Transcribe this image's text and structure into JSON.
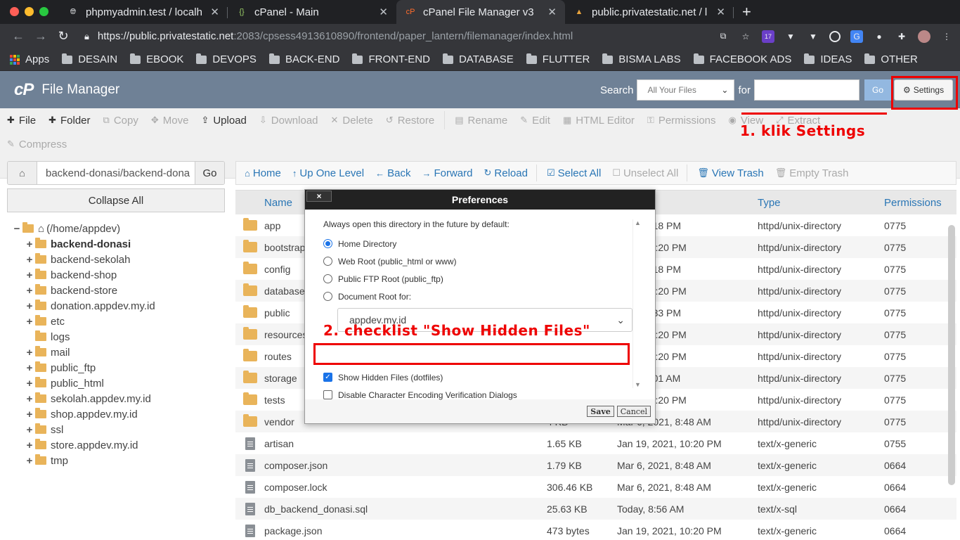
{
  "browser": {
    "tabs": [
      {
        "title": "phpmyadmin.test / localh",
        "icon": "globe-icon",
        "active": false
      },
      {
        "title": "cPanel - Main",
        "icon": "cpanel-brackets-icon",
        "active": false
      },
      {
        "title": "cPanel File Manager v3",
        "icon": "cpanel-icon",
        "active": true
      },
      {
        "title": "public.privatestatic.net / l",
        "icon": "pma-icon",
        "active": false
      }
    ],
    "url_host": "https://public.privatestatic.net",
    "url_path": ":2083/cpsess4913610890/frontend/paper_lantern/filemanager/index.html",
    "extension_badge": "17",
    "bookmarks": [
      "Apps",
      "DESAIN",
      "EBOOK",
      "DEVOPS",
      "BACK-END",
      "FRONT-END",
      "DATABASE",
      "FLUTTER",
      "BISMA LABS",
      "FACEBOOK ADS",
      "IDEAS",
      "OTHER"
    ]
  },
  "header": {
    "logo": "cP",
    "title": "File Manager",
    "search_label": "Search",
    "search_scope": "All Your Files",
    "for_label": "for",
    "go_label": "Go",
    "settings_label": "Settings"
  },
  "toolbar": {
    "row1": [
      {
        "label": "File",
        "icon": "plus-icon",
        "enabled": true
      },
      {
        "label": "Folder",
        "icon": "plus-icon",
        "enabled": true
      },
      {
        "label": "Copy",
        "icon": "copy-icon",
        "enabled": false
      },
      {
        "label": "Move",
        "icon": "move-icon",
        "enabled": false
      },
      {
        "label": "Upload",
        "icon": "upload-icon",
        "enabled": true
      },
      {
        "label": "Download",
        "icon": "download-icon",
        "enabled": false
      },
      {
        "label": "Delete",
        "icon": "delete-icon",
        "enabled": false
      },
      {
        "label": "Restore",
        "icon": "restore-icon",
        "enabled": false
      },
      {
        "label": "Rename",
        "icon": "rename-icon",
        "enabled": false
      },
      {
        "label": "Edit",
        "icon": "pencil-icon",
        "enabled": false
      },
      {
        "label": "HTML Editor",
        "icon": "html-editor-icon",
        "enabled": false
      },
      {
        "label": "Permissions",
        "icon": "key-icon",
        "enabled": false
      },
      {
        "label": "View",
        "icon": "eye-icon",
        "enabled": false
      },
      {
        "label": "Extract",
        "icon": "extract-icon",
        "enabled": false
      }
    ],
    "compress_label": "Compress"
  },
  "left_panel": {
    "path_value": "backend-donasi/backend-dona",
    "go_label": "Go",
    "collapse_label": "Collapse All",
    "root_label": "(/home/appdev)",
    "tree": [
      {
        "label": "backend-donasi",
        "bold": true,
        "plus": true
      },
      {
        "label": "backend-sekolah",
        "bold": false,
        "plus": true
      },
      {
        "label": "backend-shop",
        "bold": false,
        "plus": true
      },
      {
        "label": "backend-store",
        "bold": false,
        "plus": true
      },
      {
        "label": "donation.appdev.my.id",
        "bold": false,
        "plus": true
      },
      {
        "label": "etc",
        "bold": false,
        "plus": true
      },
      {
        "label": "logs",
        "bold": false,
        "plus": false
      },
      {
        "label": "mail",
        "bold": false,
        "plus": true
      },
      {
        "label": "public_ftp",
        "bold": false,
        "plus": true
      },
      {
        "label": "public_html",
        "bold": false,
        "plus": true
      },
      {
        "label": "sekolah.appdev.my.id",
        "bold": false,
        "plus": true
      },
      {
        "label": "shop.appdev.my.id",
        "bold": false,
        "plus": true
      },
      {
        "label": "ssl",
        "bold": false,
        "plus": true
      },
      {
        "label": "store.appdev.my.id",
        "bold": false,
        "plus": true
      },
      {
        "label": "tmp",
        "bold": false,
        "plus": true
      }
    ]
  },
  "nav_bar": [
    {
      "label": "Home",
      "icon": "home-icon",
      "enabled": true
    },
    {
      "label": "Up One Level",
      "icon": "up-arrow-icon",
      "enabled": true
    },
    {
      "label": "Back",
      "icon": "back-arrow-icon",
      "enabled": true
    },
    {
      "label": "Forward",
      "icon": "forward-arrow-icon",
      "enabled": true
    },
    {
      "label": "Reload",
      "icon": "reload-icon",
      "enabled": true
    },
    {
      "label": "Select All",
      "icon": "checkbox-checked-icon",
      "enabled": true
    },
    {
      "label": "Unselect All",
      "icon": "checkbox-empty-icon",
      "enabled": false
    },
    {
      "label": "View Trash",
      "icon": "trash-icon",
      "enabled": true
    },
    {
      "label": "Empty Trash",
      "icon": "trash-icon",
      "enabled": false
    }
  ],
  "table": {
    "headers": {
      "name": "Name",
      "modified": "ified",
      "type": "Type",
      "permissions": "Permissions"
    },
    "rows": [
      {
        "kind": "folder",
        "name": "app",
        "size": "",
        "date": "2021, 1:18 PM",
        "type": "httpd/unix-directory",
        "perm": "0775"
      },
      {
        "kind": "folder",
        "name": "bootstrap",
        "size": "",
        "date": "2021, 10:20 PM",
        "type": "httpd/unix-directory",
        "perm": "0775"
      },
      {
        "kind": "folder",
        "name": "config",
        "size": "",
        "date": "2021, 1:18 PM",
        "type": "httpd/unix-directory",
        "perm": "0775"
      },
      {
        "kind": "folder",
        "name": "database",
        "size": "",
        "date": "2021, 10:20 PM",
        "type": "httpd/unix-directory",
        "perm": "0775"
      },
      {
        "kind": "folder",
        "name": "public",
        "size": "",
        "date": "2021, 1:33 PM",
        "type": "httpd/unix-directory",
        "perm": "0775"
      },
      {
        "kind": "folder",
        "name": "resources",
        "size": "",
        "date": "2021, 10:20 PM",
        "type": "httpd/unix-directory",
        "perm": "0775"
      },
      {
        "kind": "folder",
        "name": "routes",
        "size": "",
        "date": "2021, 10:20 PM",
        "type": "httpd/unix-directory",
        "perm": "0775"
      },
      {
        "kind": "folder",
        "name": "storage",
        "size": "",
        "date": "2021, 9:01 AM",
        "type": "httpd/unix-directory",
        "perm": "0775"
      },
      {
        "kind": "folder",
        "name": "tests",
        "size": "",
        "date": "2021, 10:20 PM",
        "type": "httpd/unix-directory",
        "perm": "0775"
      },
      {
        "kind": "folder",
        "name": "vendor",
        "size": "4 KB",
        "date": "Mar 6, 2021, 8:48 AM",
        "type": "httpd/unix-directory",
        "perm": "0775"
      },
      {
        "kind": "file",
        "name": "artisan",
        "size": "1.65 KB",
        "date": "Jan 19, 2021, 10:20 PM",
        "type": "text/x-generic",
        "perm": "0755"
      },
      {
        "kind": "file",
        "name": "composer.json",
        "size": "1.79 KB",
        "date": "Mar 6, 2021, 8:48 AM",
        "type": "text/x-generic",
        "perm": "0664"
      },
      {
        "kind": "file",
        "name": "composer.lock",
        "size": "306.46 KB",
        "date": "Mar 6, 2021, 8:48 AM",
        "type": "text/x-generic",
        "perm": "0664"
      },
      {
        "kind": "sql",
        "name": "db_backend_donasi.sql",
        "size": "25.63 KB",
        "date": "Today, 8:56 AM",
        "type": "text/x-sql",
        "perm": "0664"
      },
      {
        "kind": "file",
        "name": "package.json",
        "size": "473 bytes",
        "date": "Jan 19, 2021, 10:20 PM",
        "type": "text/x-generic",
        "perm": "0664"
      }
    ]
  },
  "modal": {
    "title": "Preferences",
    "close": "×",
    "intro": "Always open this directory in the future by default:",
    "radio_options": [
      {
        "label": "Home Directory",
        "checked": true
      },
      {
        "label": "Web Root (public_html or www)",
        "checked": false
      },
      {
        "label": "Public FTP Root (public_ftp)",
        "checked": false
      },
      {
        "label": "Document Root for:",
        "checked": false
      }
    ],
    "domain_select": "appdev.my.id",
    "checkboxes": [
      {
        "label": "Show Hidden Files (dotfiles)",
        "checked": true
      },
      {
        "label": "Disable Character Encoding Verification Dialogs",
        "checked": false
      }
    ],
    "save_label": "Save",
    "cancel_label": "Cancel"
  },
  "annotations": {
    "step1": "1. klik Settings",
    "step2": "2. checklist \"Show Hidden Files\"",
    "color": "#e00000"
  }
}
